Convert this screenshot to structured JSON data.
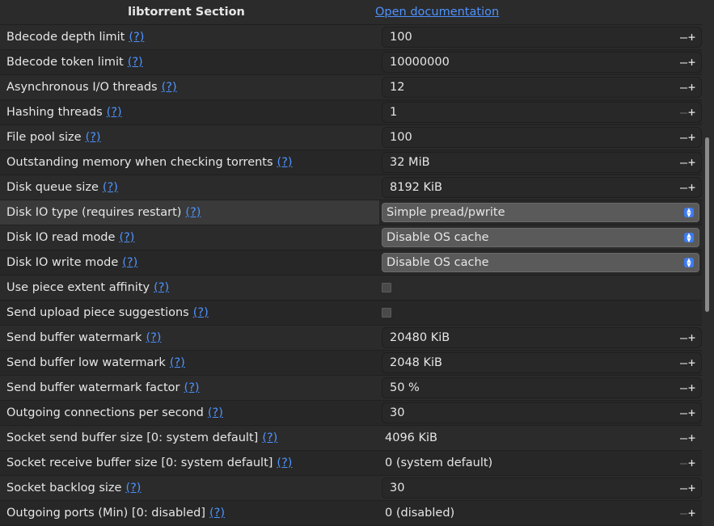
{
  "header": {
    "section": "libtorrent Section",
    "doc_link": "Open documentation"
  },
  "help_text": "(?)",
  "spin_plus": "+",
  "spin_minus": "—",
  "rows": [
    {
      "label": "Bdecode depth limit",
      "value": "100"
    },
    {
      "label": "Bdecode token limit",
      "value": "10000000"
    },
    {
      "label": "Asynchronous I/O threads",
      "value": "12"
    },
    {
      "label": "Hashing threads",
      "value": "1"
    },
    {
      "label": "File pool size",
      "value": "100"
    },
    {
      "label": "Outstanding memory when checking torrents",
      "value": "32 MiB"
    },
    {
      "label": "Disk queue size",
      "value": "8192 KiB"
    },
    {
      "label": "Disk IO type (requires restart)",
      "value": "Simple pread/pwrite"
    },
    {
      "label": "Disk IO read mode",
      "value": "Disable OS cache"
    },
    {
      "label": "Disk IO write mode",
      "value": "Disable OS cache"
    },
    {
      "label": "Use piece extent affinity",
      "checked": false
    },
    {
      "label": "Send upload piece suggestions",
      "checked": false
    },
    {
      "label": "Send buffer watermark",
      "value": "20480 KiB"
    },
    {
      "label": "Send buffer low watermark",
      "value": "2048 KiB"
    },
    {
      "label": "Send buffer watermark factor",
      "value": "50 %"
    },
    {
      "label": "Outgoing connections per second",
      "value": "30"
    },
    {
      "label": "Socket send buffer size [0: system default]",
      "value": "4096 KiB"
    },
    {
      "label": "Socket receive buffer size [0: system default]",
      "value": "0 (system default)"
    },
    {
      "label": "Socket backlog size",
      "value": "30"
    },
    {
      "label": "Outgoing ports (Min) [0: disabled]",
      "value": "0 (disabled)"
    }
  ]
}
